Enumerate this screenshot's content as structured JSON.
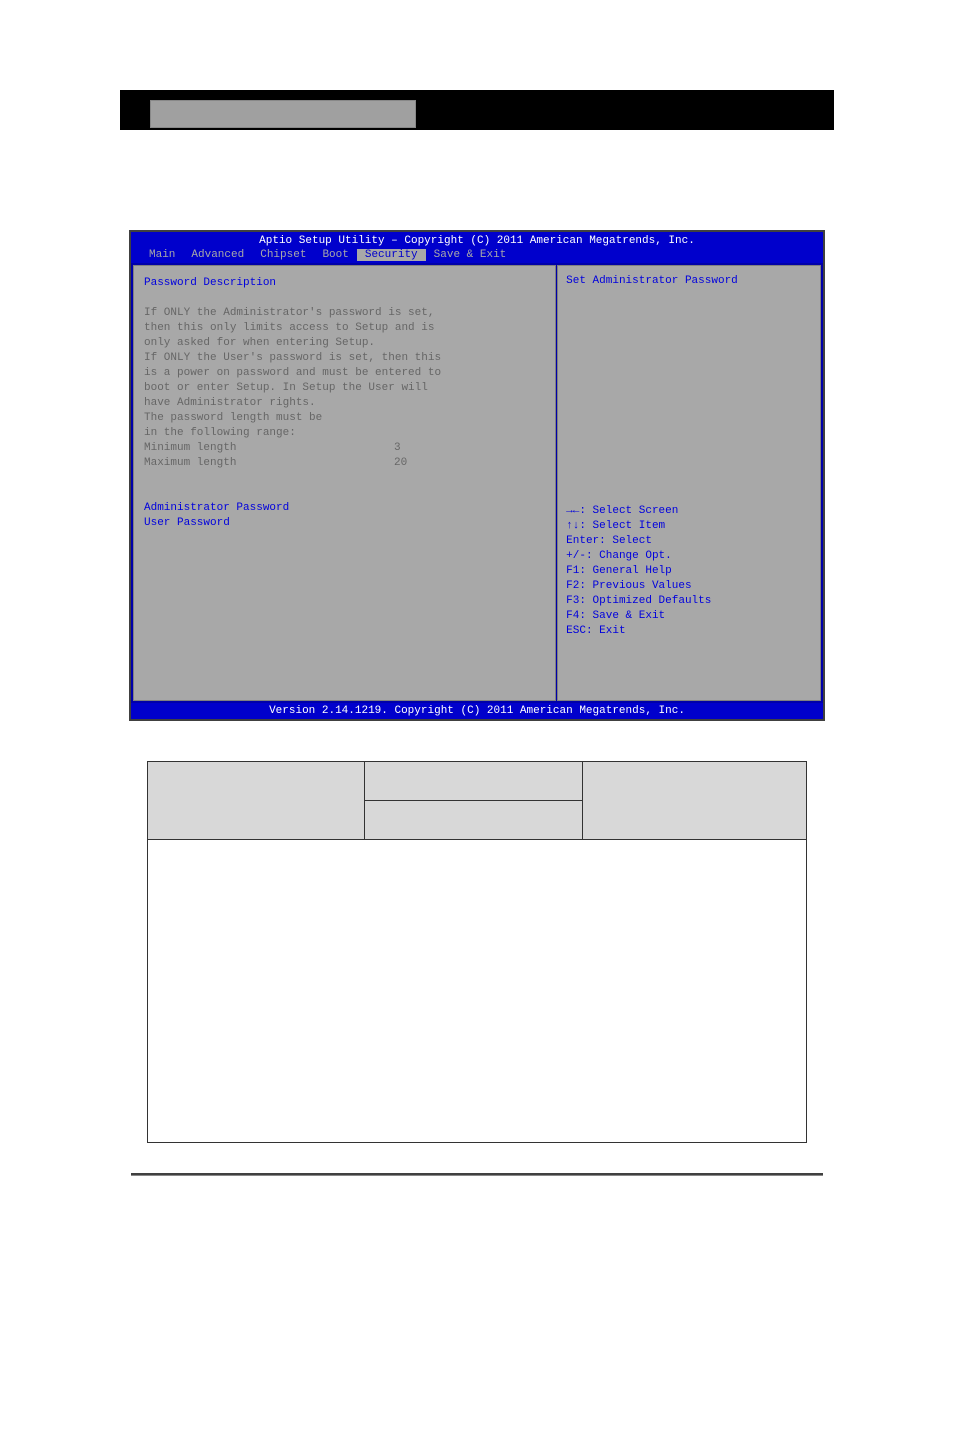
{
  "header": {
    "title": "Aptio Setup Utility – Copyright (C) 2011 American Megatrends, Inc."
  },
  "menu": {
    "items": [
      {
        "label": "Main"
      },
      {
        "label": "Advanced"
      },
      {
        "label": "Chipset"
      },
      {
        "label": "Boot"
      },
      {
        "label": "Security",
        "active": true
      },
      {
        "label": "Save & Exit"
      }
    ]
  },
  "left_panel": {
    "section_title": "Password Description",
    "desc_line1": "If ONLY the Administrator's password is set,",
    "desc_line2": "then this only limits access to Setup and is",
    "desc_line3": "only asked for when entering Setup.",
    "desc_line4": "If ONLY the User's password is set, then this",
    "desc_line5": "is a power on password and must be entered to",
    "desc_line6": "boot or enter Setup. In Setup the User will",
    "desc_line7": "have Administrator rights.",
    "desc_line8": "The password length must be",
    "desc_line9": "in the following range:",
    "min_label": "Minimum length",
    "min_value": "3",
    "max_label": "Maximum length",
    "max_value": "20",
    "admin_password": "Administrator Password",
    "user_password": "User Password"
  },
  "right_panel": {
    "help_title": "Set Administrator Password",
    "nav1": "→←: Select Screen",
    "nav2": "↑↓: Select Item",
    "nav3": "Enter: Select",
    "nav4": "+/-: Change Opt.",
    "nav5": "F1: General Help",
    "nav6": "F2: Previous Values",
    "nav7": "F3: Optimized Defaults",
    "nav8": "F4: Save & Exit",
    "nav9": "ESC: Exit"
  },
  "footer": {
    "text": "Version 2.14.1219. Copyright (C) 2011 American Megatrends, Inc."
  }
}
